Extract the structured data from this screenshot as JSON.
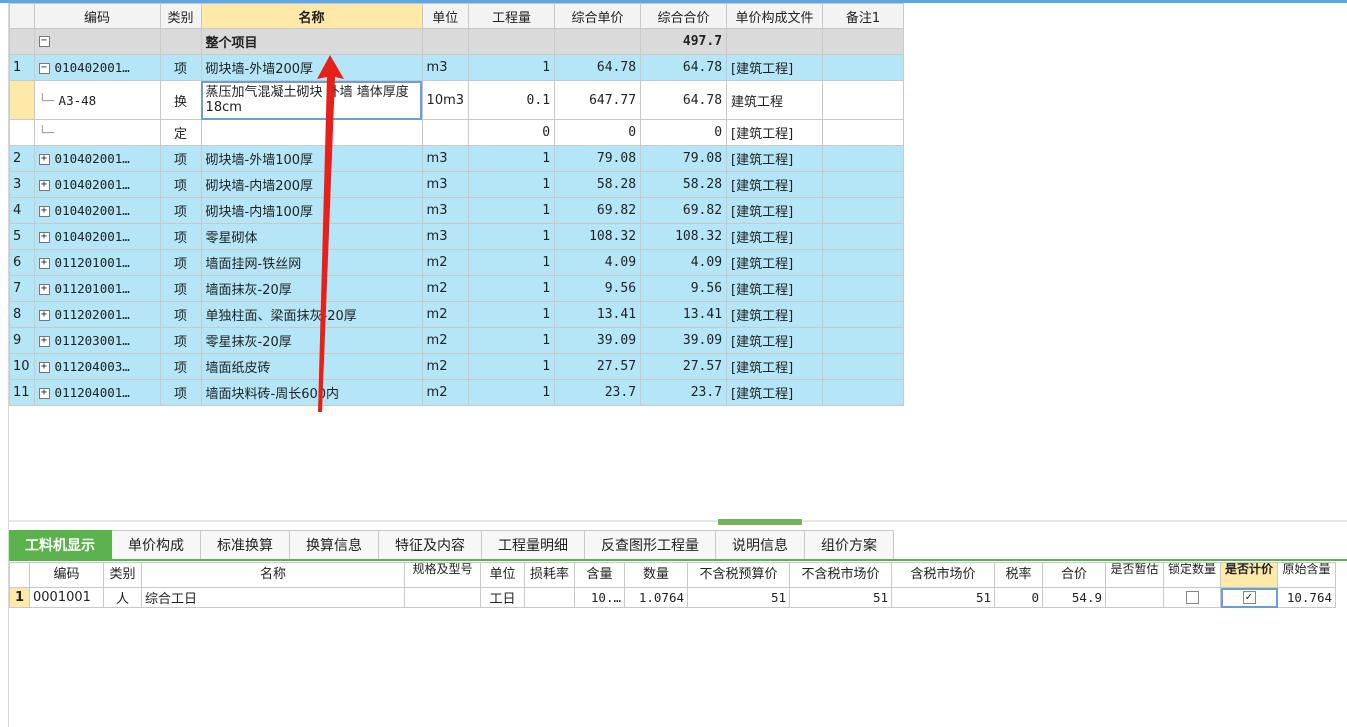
{
  "top_table": {
    "headers": [
      "",
      "编码",
      "类别",
      "名称",
      "单位",
      "工程量",
      "综合单价",
      "综合合价",
      "单价构成文件",
      "备注1"
    ],
    "group_row": {
      "name": "整个项目",
      "total": "497.7"
    },
    "rows": [
      {
        "idx": "1",
        "code": "010402001…",
        "type": "项",
        "name": "砌块墙-外墙200厚",
        "unit": "m3",
        "qty": "1",
        "unit_price": "64.78",
        "total": "64.78",
        "file": "[建筑工程]",
        "note": ""
      },
      {
        "idx": "",
        "code": "A3-48",
        "type": "换",
        "name": "蒸压加气混凝土砌块 外墙 墙体厚度 18cm",
        "unit": "10m3",
        "qty": "0.1",
        "unit_price": "647.77",
        "total": "64.78",
        "file": "建筑工程",
        "note": ""
      },
      {
        "idx": "",
        "code": "",
        "type": "定",
        "name": "",
        "unit": "",
        "qty": "0",
        "unit_price": "0",
        "total": "0",
        "file": "[建筑工程]",
        "note": ""
      },
      {
        "idx": "2",
        "code": "010402001…",
        "type": "项",
        "name": "砌块墙-外墙100厚",
        "unit": "m3",
        "qty": "1",
        "unit_price": "79.08",
        "total": "79.08",
        "file": "[建筑工程]",
        "note": ""
      },
      {
        "idx": "3",
        "code": "010402001…",
        "type": "项",
        "name": "砌块墙-内墙200厚",
        "unit": "m3",
        "qty": "1",
        "unit_price": "58.28",
        "total": "58.28",
        "file": "[建筑工程]",
        "note": ""
      },
      {
        "idx": "4",
        "code": "010402001…",
        "type": "项",
        "name": "砌块墙-内墙100厚",
        "unit": "m3",
        "qty": "1",
        "unit_price": "69.82",
        "total": "69.82",
        "file": "[建筑工程]",
        "note": ""
      },
      {
        "idx": "5",
        "code": "010402001…",
        "type": "项",
        "name": "零星砌体",
        "unit": "m3",
        "qty": "1",
        "unit_price": "108.32",
        "total": "108.32",
        "file": "[建筑工程]",
        "note": ""
      },
      {
        "idx": "6",
        "code": "011201001…",
        "type": "项",
        "name": "墙面挂网-铁丝网",
        "unit": "m2",
        "qty": "1",
        "unit_price": "4.09",
        "total": "4.09",
        "file": "[建筑工程]",
        "note": ""
      },
      {
        "idx": "7",
        "code": "011201001…",
        "type": "项",
        "name": "墙面抹灰-20厚",
        "unit": "m2",
        "qty": "1",
        "unit_price": "9.56",
        "total": "9.56",
        "file": "[建筑工程]",
        "note": ""
      },
      {
        "idx": "8",
        "code": "011202001…",
        "type": "项",
        "name": "单独柱面、梁面抹灰-20厚",
        "unit": "m2",
        "qty": "1",
        "unit_price": "13.41",
        "total": "13.41",
        "file": "[建筑工程]",
        "note": ""
      },
      {
        "idx": "9",
        "code": "011203001…",
        "type": "项",
        "name": "零星抹灰-20厚",
        "unit": "m2",
        "qty": "1",
        "unit_price": "39.09",
        "total": "39.09",
        "file": "[建筑工程]",
        "note": ""
      },
      {
        "idx": "10",
        "code": "011204003…",
        "type": "项",
        "name": "墙面纸皮砖",
        "unit": "m2",
        "qty": "1",
        "unit_price": "27.57",
        "total": "27.57",
        "file": "[建筑工程]",
        "note": ""
      },
      {
        "idx": "11",
        "code": "011204001…",
        "type": "项",
        "name": "墙面块料砖-周长600内",
        "unit": "m2",
        "qty": "1",
        "unit_price": "23.7",
        "total": "23.7",
        "file": "[建筑工程]",
        "note": ""
      }
    ]
  },
  "tabs": [
    "工料机显示",
    "单价构成",
    "标准换算",
    "换算信息",
    "特征及内容",
    "工程量明细",
    "反查图形工程量",
    "说明信息",
    "组价方案"
  ],
  "bottom_table": {
    "headers": [
      "",
      "编码",
      "类别",
      "名称",
      "规格及型号",
      "单位",
      "损耗率",
      "含量",
      "数量",
      "不含税预算价",
      "不含税市场价",
      "含税市场价",
      "税率",
      "合价",
      "是否暂估",
      "锁定数量",
      "是否计价",
      "原始含量"
    ],
    "rows": [
      {
        "idx": "1",
        "code": "0001001",
        "type": "人",
        "name": "综合工日",
        "spec": "",
        "unit": "工日",
        "loss": "",
        "content": "10.…",
        "qty": "1.0764",
        "budget": "51",
        "market": "51",
        "tax_market": "51",
        "tax_rate": "0",
        "total": "54.9",
        "provisional": "",
        "lock": "",
        "priced": "✓",
        "orig": "10.764"
      }
    ]
  },
  "colors": {
    "row_blue": "#b4e6f7",
    "accent_green": "#5bb14c",
    "selected_header": "#ffe9a8",
    "arrow_red": "#e8201a"
  }
}
